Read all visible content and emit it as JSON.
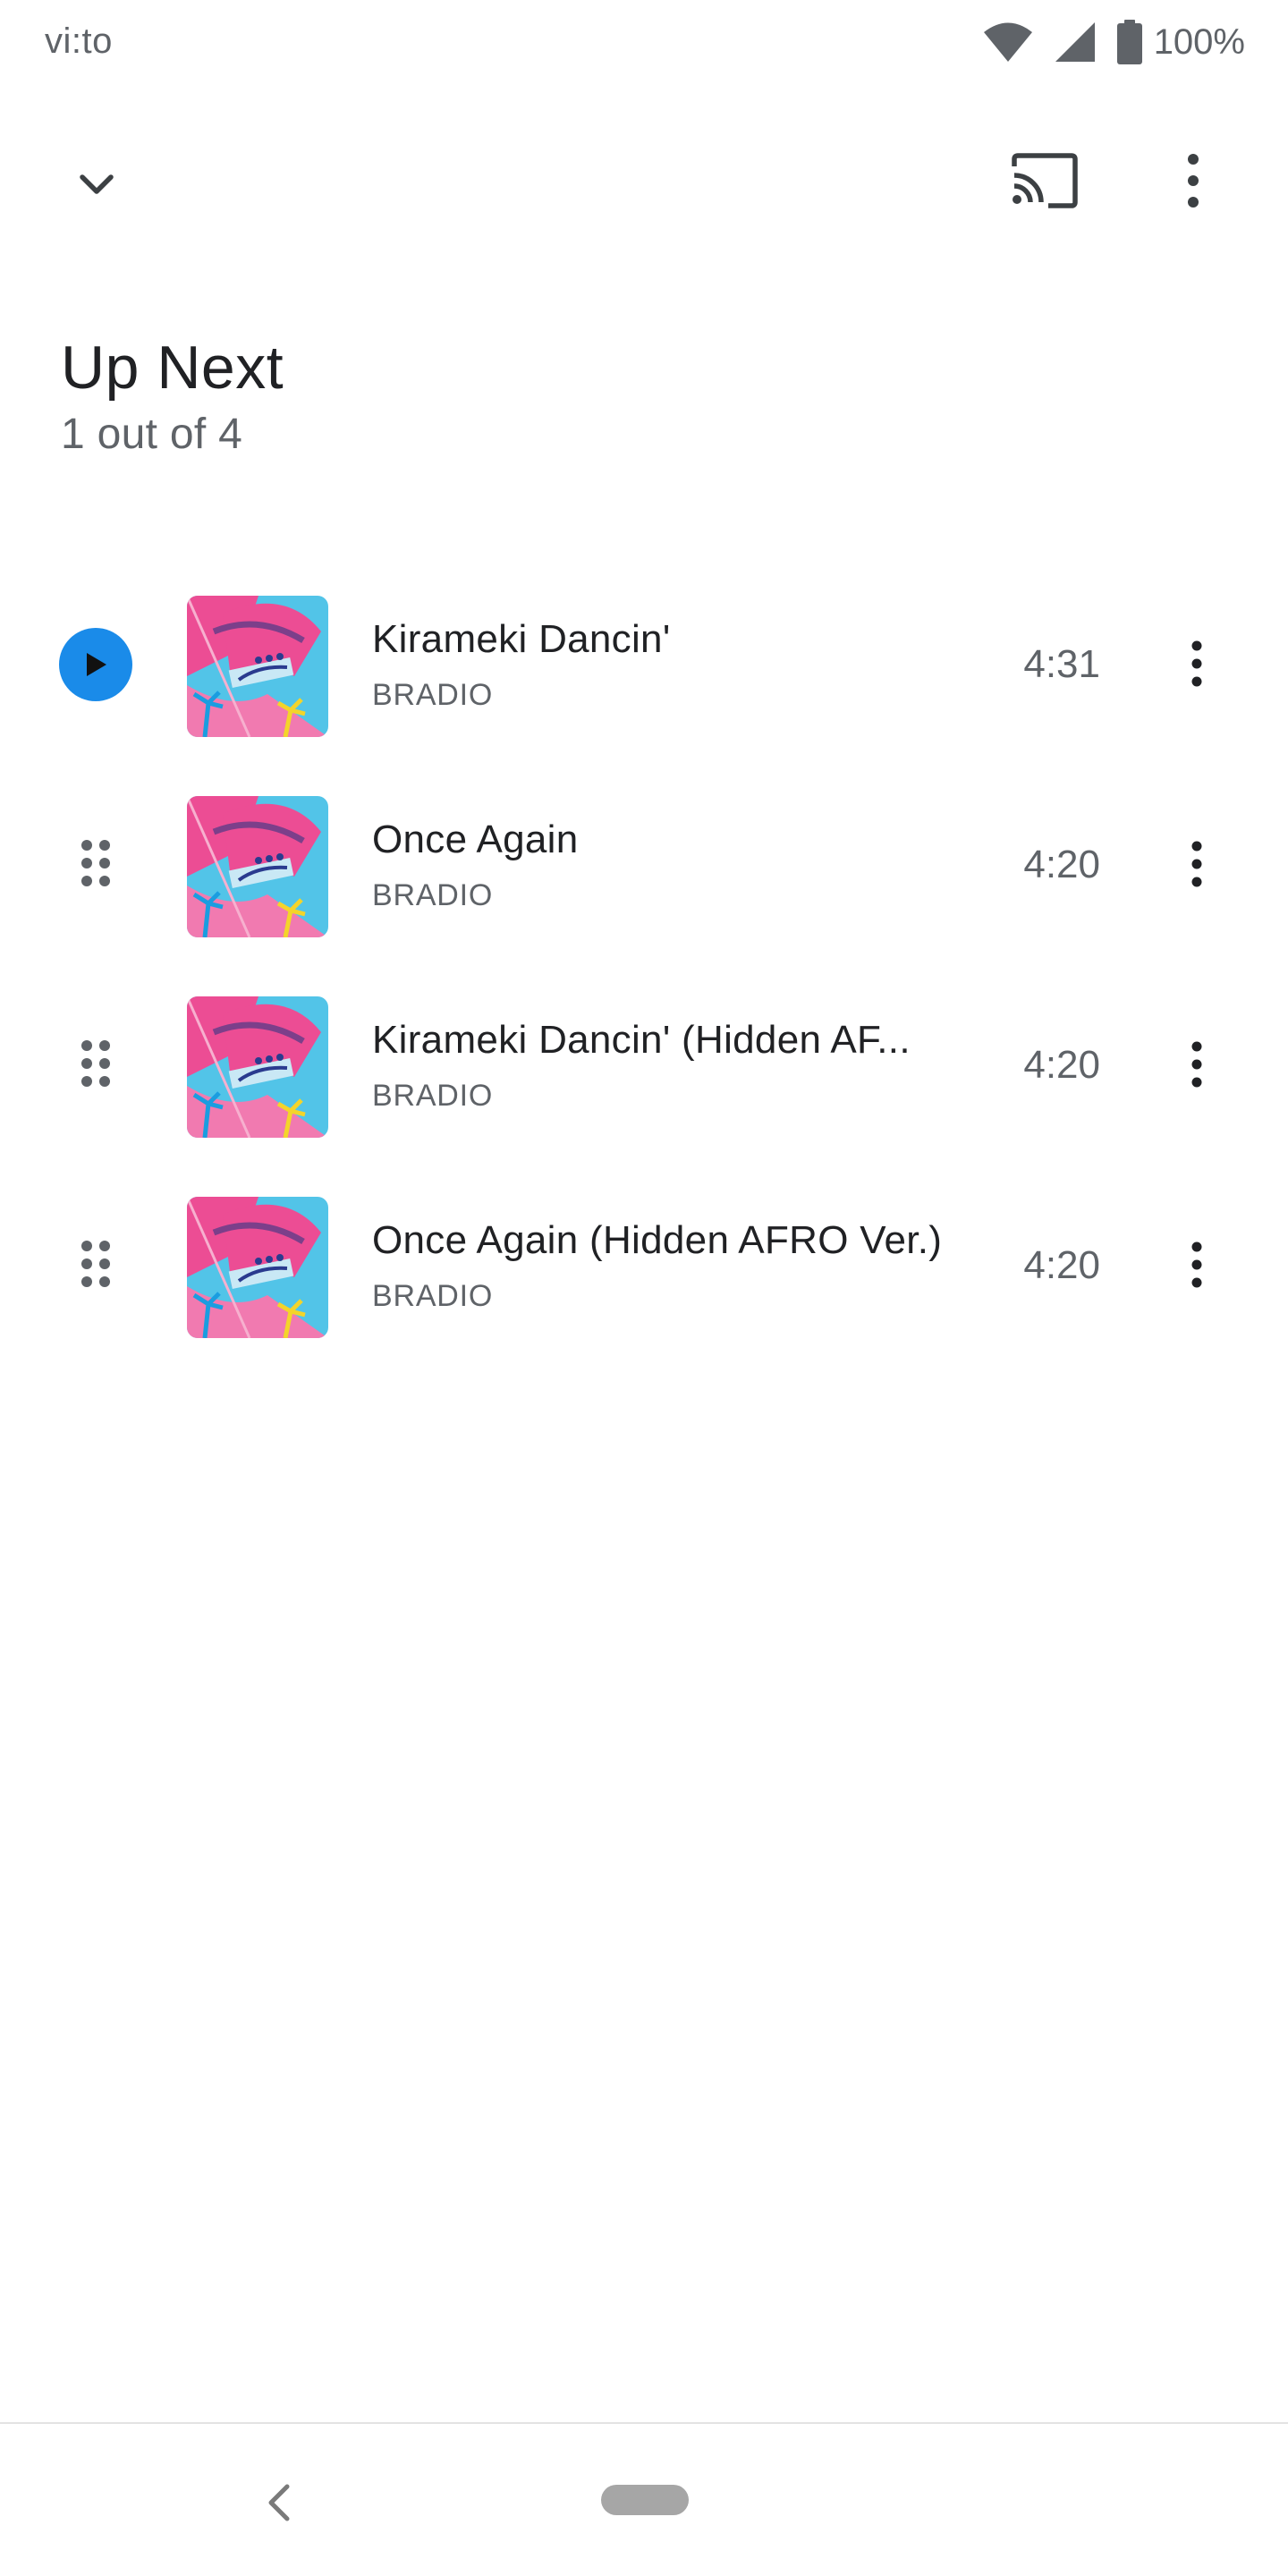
{
  "status_bar": {
    "carrier": "vi:to",
    "battery": "100%",
    "icons": [
      "wifi-icon",
      "signal-icon",
      "battery-icon"
    ]
  },
  "app_bar": {
    "icons": [
      "chevron-down-icon",
      "cast-icon",
      "more-vert-icon"
    ]
  },
  "header": {
    "title": "Up Next",
    "subtitle": "1 out of 4"
  },
  "queue": [
    {
      "title": "Kirameki Dancin'",
      "artist": "BRADIO",
      "duration": "4:31",
      "state": "playing",
      "lead_icon": "play-icon"
    },
    {
      "title": "Once Again",
      "artist": "BRADIO",
      "duration": "4:20",
      "state": "queued",
      "lead_icon": "drag-handle-icon"
    },
    {
      "title": "Kirameki Dancin' (Hidden AF...",
      "artist": "BRADIO",
      "duration": "4:20",
      "state": "queued",
      "lead_icon": "drag-handle-icon"
    },
    {
      "title": "Once Again (Hidden AFRO Ver.)",
      "artist": "BRADIO",
      "duration": "4:20",
      "state": "queued",
      "lead_icon": "drag-handle-icon"
    }
  ],
  "nav_bar": {
    "icons": [
      "back-icon",
      "home-pill"
    ]
  },
  "colors": {
    "accent": "#1a8be9",
    "text_primary": "#202124",
    "text_secondary": "#5f6368",
    "album_pink": "#ec4d94",
    "album_cyan": "#52c4e8"
  }
}
